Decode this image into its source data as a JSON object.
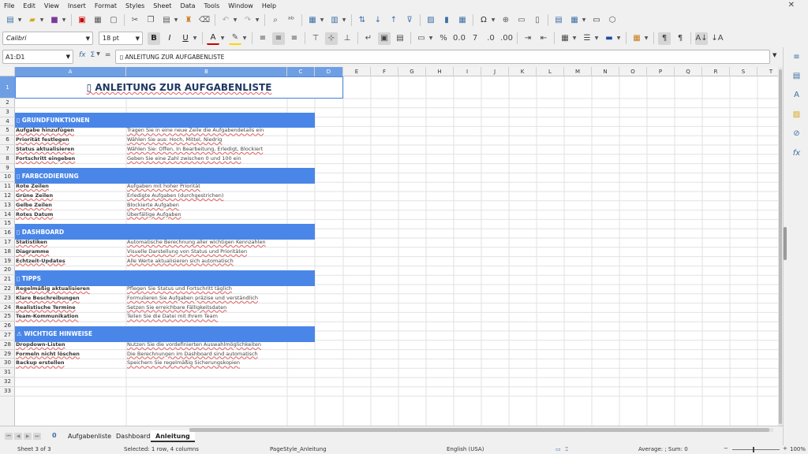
{
  "menu": [
    "File",
    "Edit",
    "View",
    "Insert",
    "Format",
    "Styles",
    "Sheet",
    "Data",
    "Tools",
    "Window",
    "Help"
  ],
  "toolbar": {
    "font_name": "Calibri",
    "font_size": "18 pt"
  },
  "formula_bar": {
    "name_box": "A1:D1",
    "sum_icon": "Σ",
    "equals_icon": "=",
    "content": "▯ ANLEITUNG ZUR AUFGABENLISTE"
  },
  "columns": [
    "A",
    "B",
    "C",
    "D",
    "E",
    "F",
    "G",
    "H",
    "I",
    "J",
    "K",
    "L",
    "M",
    "N",
    "O",
    "P",
    "Q",
    "R",
    "S",
    "T"
  ],
  "rows": [
    "1",
    "2",
    "3",
    "4",
    "5",
    "6",
    "7",
    "8",
    "9",
    "10",
    "11",
    "12",
    "13",
    "14",
    "15",
    "16",
    "17",
    "18",
    "19",
    "20",
    "21",
    "22",
    "23",
    "24",
    "25",
    "26",
    "27",
    "28",
    "29",
    "30",
    "31",
    "32",
    "33"
  ],
  "sheet": {
    "title": "▯ ANLEITUNG ZUR AUFGABENLISTE",
    "sections": [
      {
        "row": 4,
        "heading": "▯ GRUNDFUNKTIONEN",
        "items": [
          {
            "row": 5,
            "key": "Aufgabe hinzufügen",
            "value": "Tragen Sie in eine neue Zeile die Aufgabendetails ein"
          },
          {
            "row": 6,
            "key": "Priorität festlegen",
            "value": "Wählen Sie aus: Hoch, Mittel, Niedrig"
          },
          {
            "row": 7,
            "key": "Status aktualisieren",
            "value": "Wählen Sie: Offen, In Bearbeitung, Erledigt, Blockiert"
          },
          {
            "row": 8,
            "key": "Fortschritt eingeben",
            "value": "Geben Sie eine Zahl zwischen 0 und 100 ein"
          }
        ]
      },
      {
        "row": 10,
        "heading": "▯ FARBCODIERUNG",
        "items": [
          {
            "row": 11,
            "key": "Rote Zeilen",
            "value": "Aufgaben mit hoher Priorität"
          },
          {
            "row": 12,
            "key": "Grüne Zeilen",
            "value": "Erledigte Aufgaben (durchgestrichen)"
          },
          {
            "row": 13,
            "key": "Gelbe Zeilen",
            "value": "Blockierte Aufgaben"
          },
          {
            "row": 14,
            "key": "Rotes Datum",
            "value": "Überfällige Aufgaben"
          }
        ]
      },
      {
        "row": 16,
        "heading": "▯ DASHBOARD",
        "items": [
          {
            "row": 17,
            "key": "Statistiken",
            "value": "Automatische Berechnung aller wichtigen Kennzahlen"
          },
          {
            "row": 18,
            "key": "Diagramme",
            "value": "Visuelle Darstellung von Status und Prioritäten"
          },
          {
            "row": 19,
            "key": "Echtzeit-Updates",
            "value": "Alle Werte aktualisieren sich automatisch"
          }
        ]
      },
      {
        "row": 21,
        "heading": "▯ TIPPS",
        "items": [
          {
            "row": 22,
            "key": "Regelmäßig aktualisieren",
            "value": "Pflegen Sie Status und Fortschritt täglich"
          },
          {
            "row": 23,
            "key": "Klare Beschreibungen",
            "value": "Formulieren Sie Aufgaben präzise und verständlich"
          },
          {
            "row": 24,
            "key": "Realistische Termine",
            "value": "Setzen Sie erreichbare Fälligkeitsdaten"
          },
          {
            "row": 25,
            "key": "Team-Kommunikation",
            "value": "Teilen Sie die Datei mit Ihrem Team"
          }
        ]
      },
      {
        "row": 27,
        "heading": "⚠ WICHTIGE HINWEISE",
        "items": [
          {
            "row": 28,
            "key": "Dropdown-Listen",
            "value": "Nutzen Sie die vordefinierten Auswahlmöglichkeiten"
          },
          {
            "row": 29,
            "key": "Formeln nicht löschen",
            "value": "Die Berechnungen im Dashboard sind automatisch"
          },
          {
            "row": 30,
            "key": "Backup erstellen",
            "value": "Speichern Sie regelmäßig Sicherungskopien"
          }
        ]
      }
    ]
  },
  "tabs": {
    "add": "0",
    "items": [
      "Aufgabenliste",
      "Dashboard",
      "Anleitung"
    ],
    "active": "Anleitung"
  },
  "status": {
    "sheet": "Sheet 3 of 3",
    "selection": "Selected: 1 row, 4 columns",
    "page_style": "PageStyle_Anleitung",
    "language": "English (USA)",
    "summary": "Average: ; Sum: 0",
    "zoom": "100%"
  },
  "colors": {
    "band": "#4a86e8",
    "title_text": "#1f3864",
    "selection": "#6e9fe4"
  }
}
